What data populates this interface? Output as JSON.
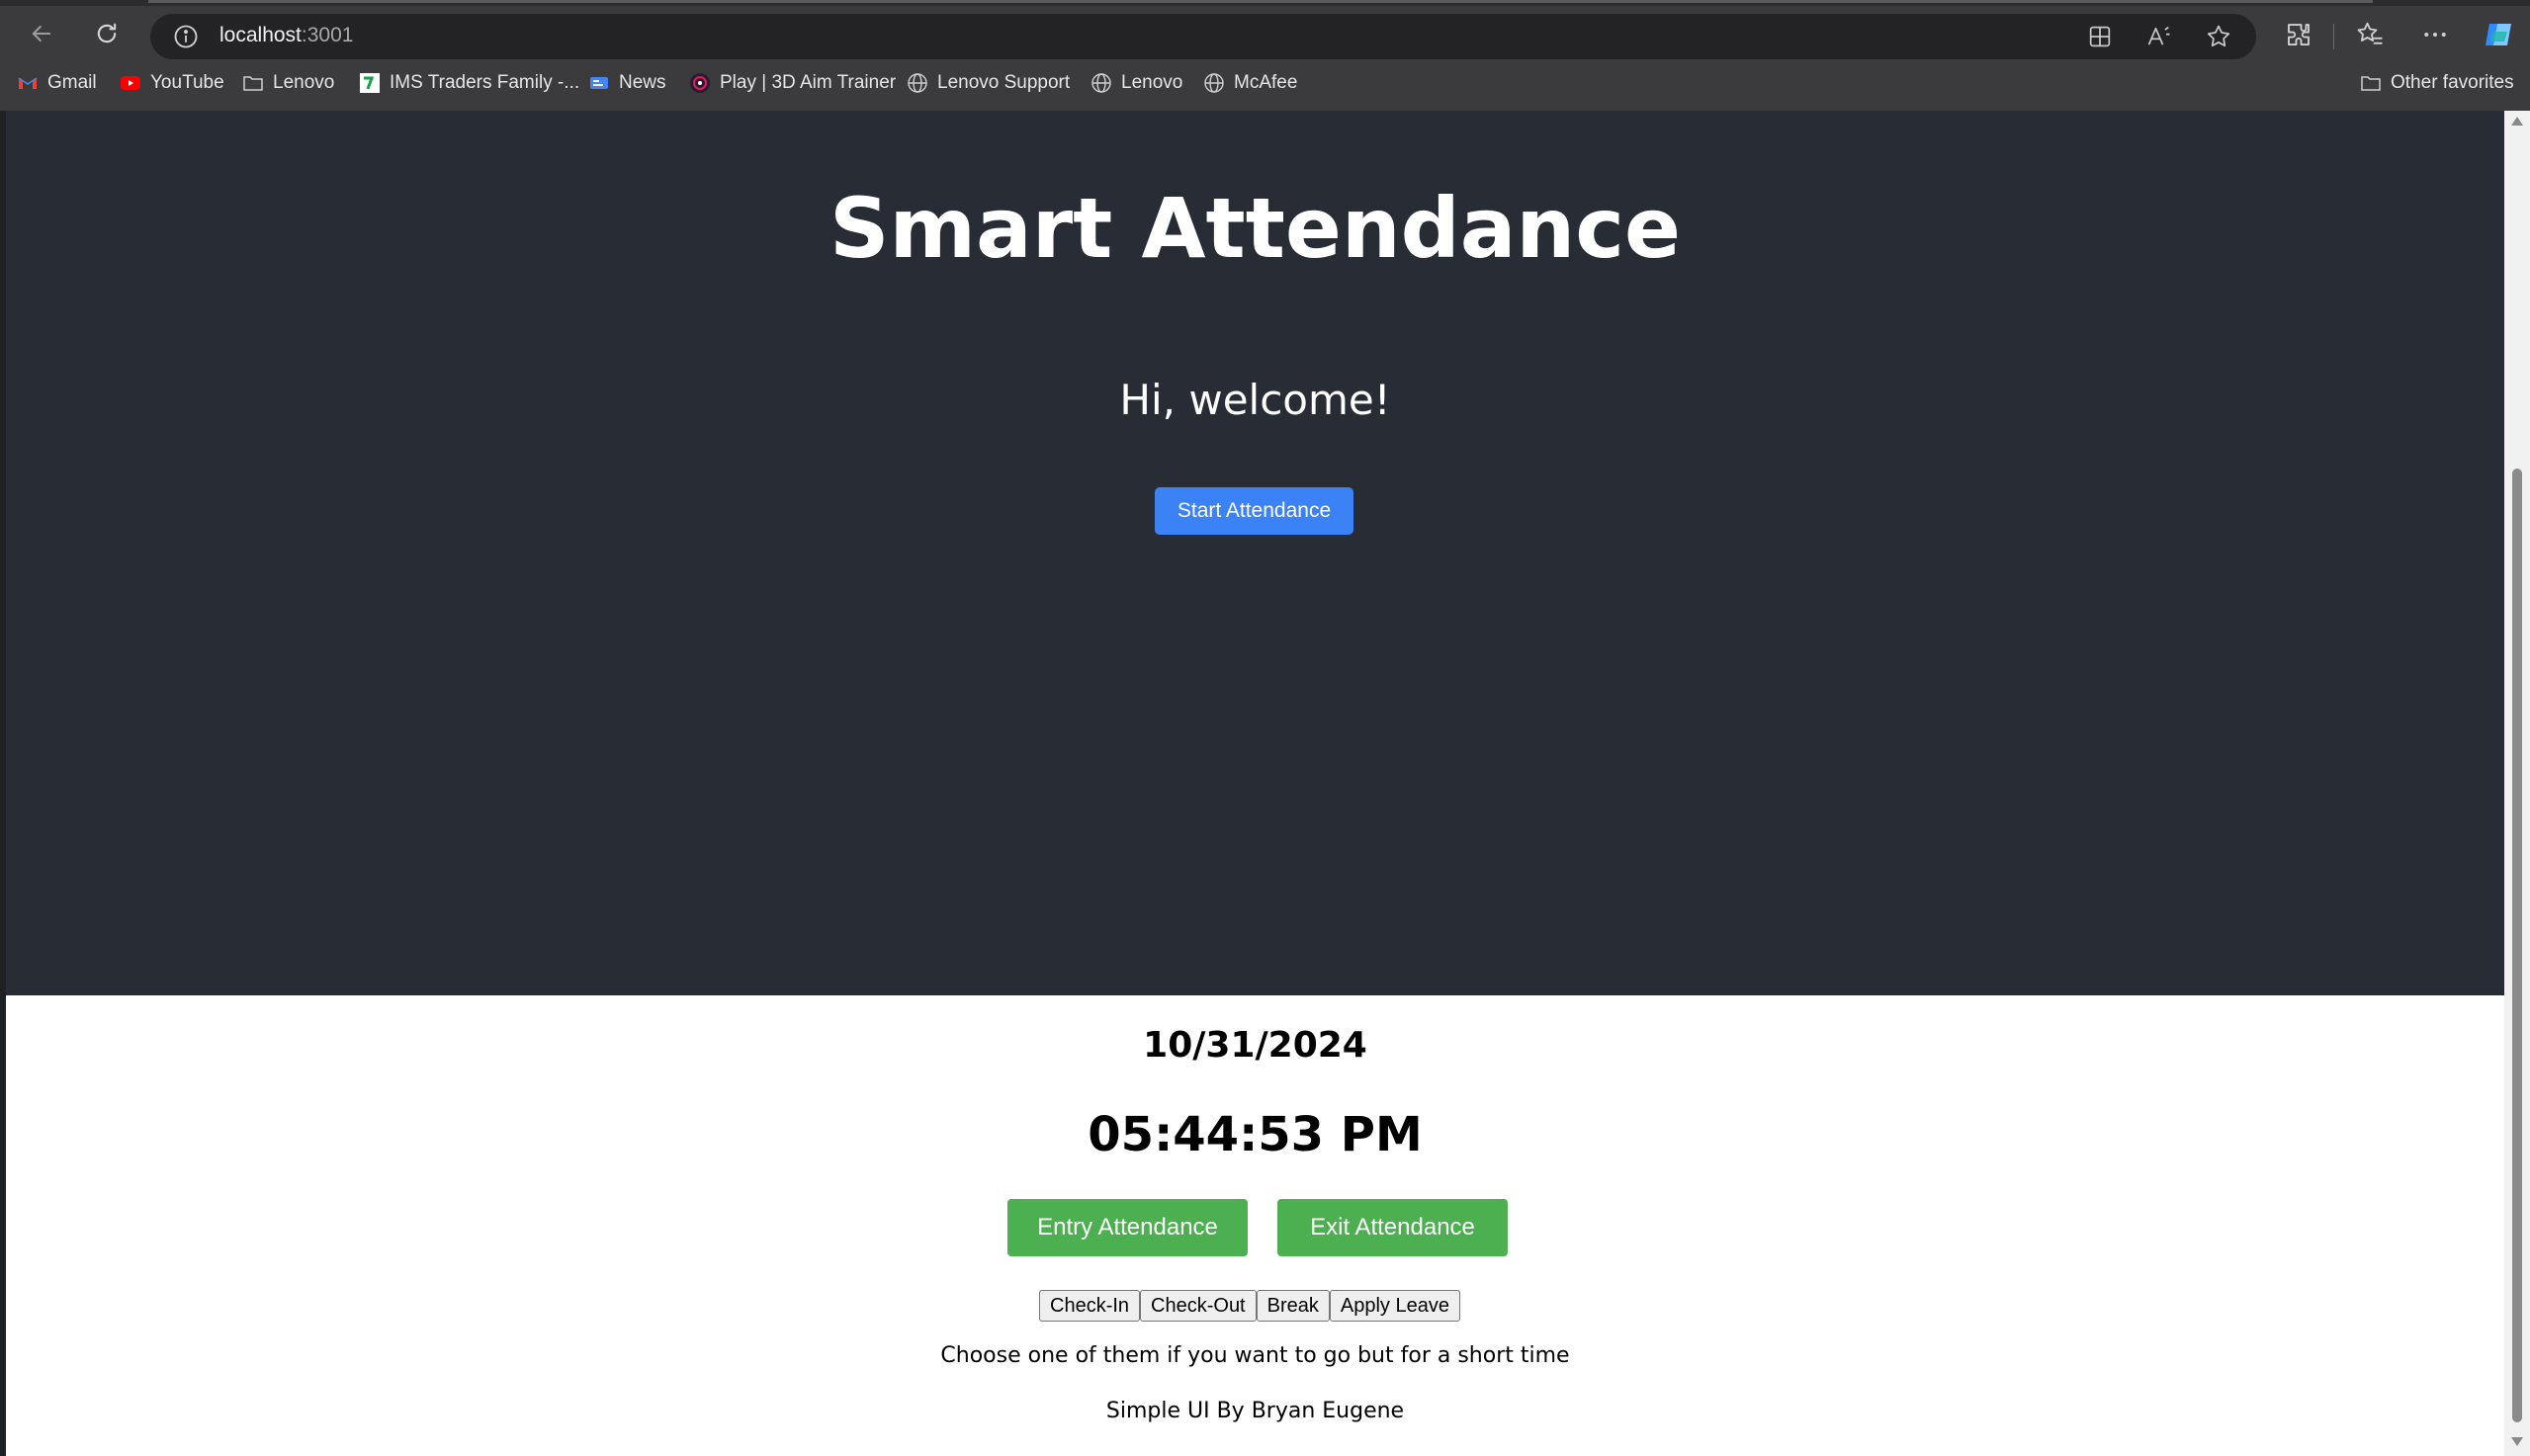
{
  "browser": {
    "url_host": "localhost",
    "url_port": ":3001",
    "bookmarks": [
      {
        "label": "Gmail",
        "icon": "gmail-icon"
      },
      {
        "label": "YouTube",
        "icon": "youtube-icon"
      },
      {
        "label": "Lenovo",
        "icon": "folder-icon"
      },
      {
        "label": "IMS Traders Family -...",
        "icon": "ims-icon"
      },
      {
        "label": "News",
        "icon": "news-icon"
      },
      {
        "label": "Play | 3D Aim Trainer",
        "icon": "aim-trainer-icon"
      },
      {
        "label": "Lenovo Support",
        "icon": "globe-icon"
      },
      {
        "label": "Lenovo",
        "icon": "globe-icon"
      },
      {
        "label": "McAfee",
        "icon": "globe-icon"
      }
    ],
    "other_favorites": "Other favorites"
  },
  "page": {
    "title": "Smart Attendance",
    "welcome": "Hi, welcome!",
    "start_button": "Start Attendance",
    "date": "10/31/2024",
    "time": "05:44:53 PM",
    "entry_button": "Entry Attendance",
    "exit_button": "Exit Attendance",
    "small_buttons": [
      "Check-In",
      "Check-Out",
      "Break",
      "Apply Leave"
    ],
    "hint": "Choose one of them if you want to go but for a short time",
    "credit": "Simple UI By Bryan Eugene"
  },
  "colors": {
    "hero_bg": "#282c34",
    "primary_button": "#3b82f6",
    "green_button": "#4caf50"
  }
}
